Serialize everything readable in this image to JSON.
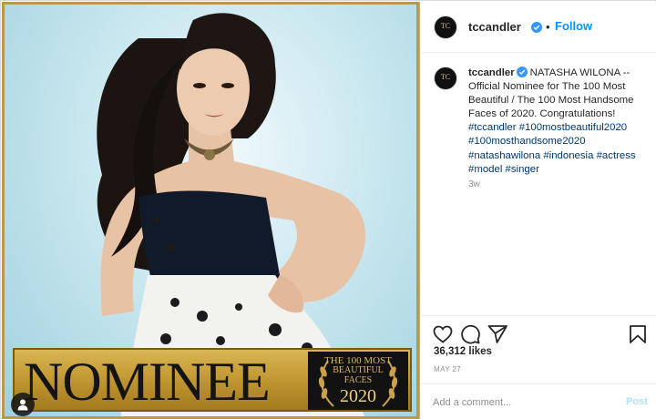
{
  "post": {
    "photo_alt": "Portrait photo of a woman in a strapless black and white floral dress",
    "banner": {
      "word": "NOMINEE",
      "seal_line1": "THE 100 MOST",
      "seal_line2": "BEAUTIFUL",
      "seal_line3": "FACES",
      "seal_year": "2020"
    },
    "colors": {
      "gold": "#c49a34",
      "link_blue": "#0095f6",
      "hashtag_blue": "#00376b",
      "verified_blue": "#3897f0"
    }
  },
  "header": {
    "avatar_mono": "TC",
    "username": "tccandler",
    "separator": "•",
    "follow_label": "Follow"
  },
  "caption": {
    "username": "tccandler",
    "text": "NATASHA WILONA -- Official Nominee for The 100 Most Beautiful / The 100 Most Handsome Faces of 2020. Congratulations!",
    "hashtags": "#tccandler #100mostbeautiful2020 #100mosthandsome2020 #natashawilona #indonesia #actress #model #singer",
    "time_ago": "3w"
  },
  "actions": {
    "icons": [
      "heart-icon",
      "comment-icon",
      "share-icon",
      "bookmark-icon"
    ],
    "likes": "36,312 likes",
    "date": "MAY 27"
  },
  "comment": {
    "placeholder": "Add a comment...",
    "post_label": "Post"
  }
}
